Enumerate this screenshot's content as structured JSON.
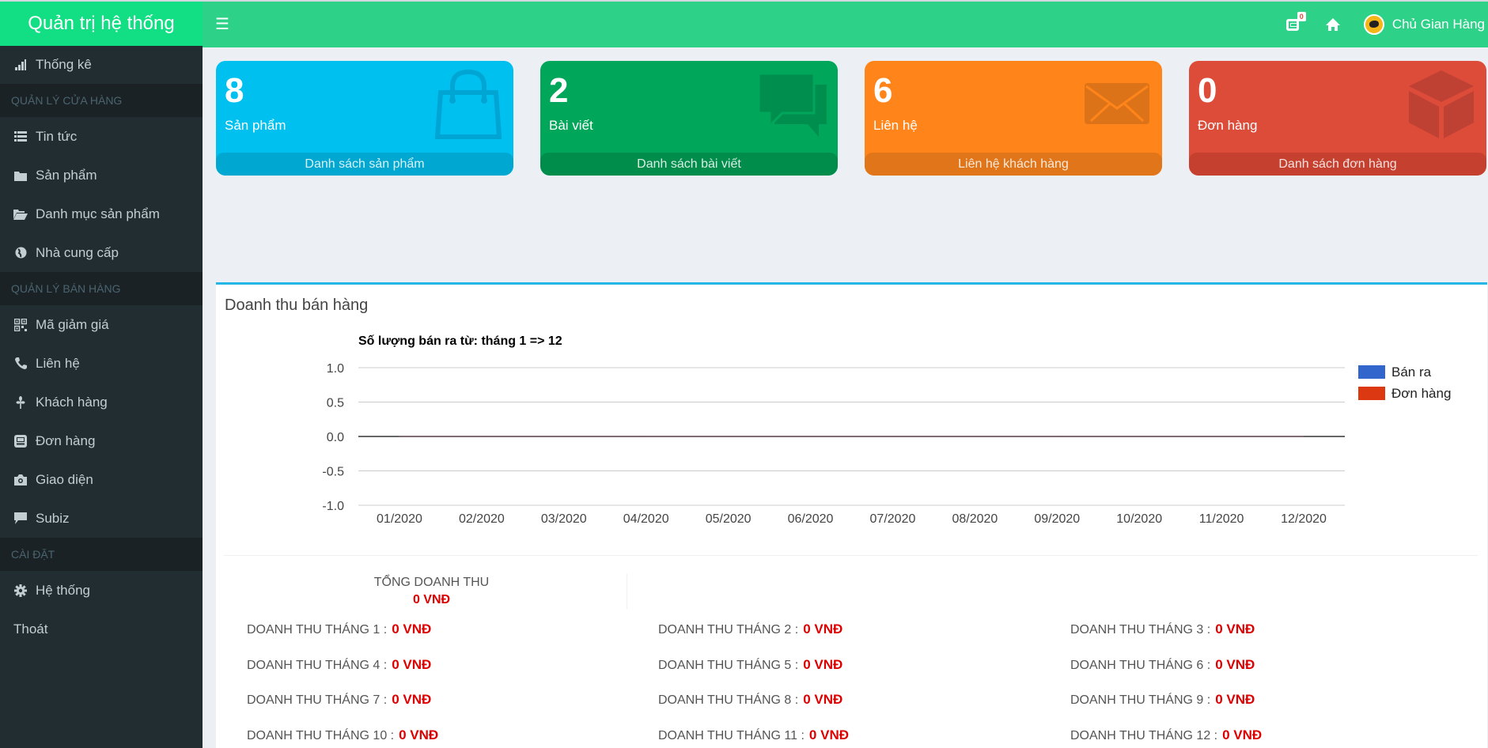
{
  "app": {
    "title": "Quản trị hệ thống",
    "menu_icon": "hamburger-icon"
  },
  "topbar": {
    "notification_count": "0",
    "user_name": "Chủ Gian Hàng",
    "icons": [
      "notification-icon",
      "home-icon",
      "avatar"
    ]
  },
  "sidebar": {
    "items": [
      {
        "type": "item",
        "label": "Thống kê",
        "icon": "bar-chart-icon"
      },
      {
        "type": "header",
        "label": "QUẢN LÝ CỬA HÀNG"
      },
      {
        "type": "item",
        "label": "Tin tức",
        "icon": "list-icon"
      },
      {
        "type": "item",
        "label": "Sản phẩm",
        "icon": "folder-icon"
      },
      {
        "type": "item",
        "label": "Danh mục sản phẩm",
        "icon": "folder-open-icon"
      },
      {
        "type": "item",
        "label": "Nhà cung cấp",
        "icon": "globe-icon"
      },
      {
        "type": "header",
        "label": "QUẢN LÝ BÁN HÀNG"
      },
      {
        "type": "item",
        "label": "Mã giảm giá",
        "icon": "qrcode-icon"
      },
      {
        "type": "item",
        "label": "Liên hệ",
        "icon": "phone-icon"
      },
      {
        "type": "item",
        "label": "Khách hàng",
        "icon": "grain-icon"
      },
      {
        "type": "item",
        "label": "Đơn hàng",
        "icon": "order-icon"
      },
      {
        "type": "item",
        "label": "Giao diện",
        "icon": "camera-icon"
      },
      {
        "type": "item",
        "label": "Subiz",
        "icon": "comment-icon"
      },
      {
        "type": "header",
        "label": "CÀI ĐẶT"
      },
      {
        "type": "item",
        "label": "Hệ thống",
        "icon": "gear-icon"
      },
      {
        "type": "item",
        "label": "Thoát",
        "icon": ""
      }
    ]
  },
  "cards": [
    {
      "value": "8",
      "label": "Sản phẩm",
      "footer": "Danh sách sản phẩm",
      "icon": "shopping-bag-icon",
      "color": "#00c0ef",
      "footer_color": "#00a7d0",
      "icon_color": "#00a5d3"
    },
    {
      "value": "2",
      "label": "Bài viết",
      "footer": "Danh sách bài viết",
      "icon": "comments-icon",
      "color": "#00a65a",
      "footer_color": "#008d4c",
      "icon_color": "#008e4f"
    },
    {
      "value": "6",
      "label": "Liên hệ",
      "footer": "Liên hệ khách hàng",
      "icon": "envelope-icon",
      "color": "#ff851b",
      "footer_color": "#e07519",
      "icon_color": "#dc7318"
    },
    {
      "value": "0",
      "label": "Đơn hàng",
      "footer": "Danh sách đơn hàng",
      "icon": "cube-icon",
      "color": "#dd4b39",
      "footer_color": "#c64030",
      "icon_color": "#bf4133"
    }
  ],
  "revenue_panel": {
    "title": "Doanh thu bán hàng",
    "total_label": "TỔNG DOANH THU",
    "total_value": "0 VNĐ",
    "months": [
      {
        "label": "DOANH THU THÁNG 1 :",
        "value": "0 VNĐ"
      },
      {
        "label": "DOANH THU THÁNG 2 :",
        "value": "0 VNĐ"
      },
      {
        "label": "DOANH THU THÁNG 3 :",
        "value": "0 VNĐ"
      },
      {
        "label": "DOANH THU THÁNG 4 :",
        "value": "0 VNĐ"
      },
      {
        "label": "DOANH THU THÁNG 5 :",
        "value": "0 VNĐ"
      },
      {
        "label": "DOANH THU THÁNG 6 :",
        "value": "0 VNĐ"
      },
      {
        "label": "DOANH THU THÁNG 7 :",
        "value": "0 VNĐ"
      },
      {
        "label": "DOANH THU THÁNG 8 :",
        "value": "0 VNĐ"
      },
      {
        "label": "DOANH THU THÁNG 9 :",
        "value": "0 VNĐ"
      },
      {
        "label": "DOANH THU THÁNG 10 :",
        "value": "0 VNĐ"
      },
      {
        "label": "DOANH THU THÁNG 11 :",
        "value": "0 VNĐ"
      },
      {
        "label": "DOANH THU THÁNG 12 :",
        "value": "0 VNĐ"
      }
    ]
  },
  "chart_data": {
    "type": "line",
    "title": "Số lượng bán ra từ: tháng 1 => 12",
    "categories": [
      "01/2020",
      "02/2020",
      "03/2020",
      "04/2020",
      "05/2020",
      "06/2020",
      "07/2020",
      "08/2020",
      "09/2020",
      "10/2020",
      "11/2020",
      "12/2020"
    ],
    "series": [
      {
        "name": "Bán ra",
        "color": "#3366cc",
        "values": [
          0,
          0,
          0,
          0,
          0,
          0,
          0,
          0,
          0,
          0,
          0,
          0
        ]
      },
      {
        "name": "Đơn hàng",
        "color": "#dc3912",
        "values": [
          0,
          0,
          0,
          0,
          0,
          0,
          0,
          0,
          0,
          0,
          0,
          0
        ]
      }
    ],
    "yticks": [
      "1.0",
      "0.5",
      "0.0",
      "-0.5",
      "-1.0"
    ],
    "ylim": [
      -1,
      1
    ],
    "xlabel": "",
    "ylabel": "",
    "grid": true,
    "legend": "right"
  }
}
